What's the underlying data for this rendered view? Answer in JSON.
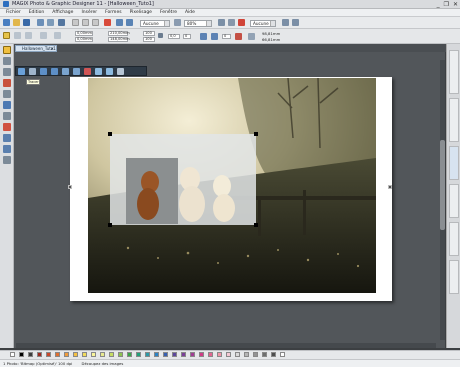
{
  "window": {
    "title": "MAGIX Photo & Graphic Designer 11 - [Halloween_Tuto1]",
    "controls": [
      "_",
      "❐",
      "✕"
    ]
  },
  "menu": [
    "Fichier",
    "Edition",
    "Affichage",
    "Insérer",
    "Formes",
    "Pixelisage",
    "Fenêtre",
    "Aide"
  ],
  "toolbar1": {
    "font_combo": "Aucune",
    "zoom_combo": "80%",
    "mode_combo": "Aucune"
  },
  "toolbar2": {
    "x1": "0,00mm",
    "y1": "0,00mm",
    "w": "210,00mm",
    "h": "148,00mm",
    "scale_w": "100",
    "scale_h": "100",
    "angle": "0,0",
    "val1": "0",
    "val2": "0",
    "pix1": "98,81mm",
    "pix2": "66,81mm"
  },
  "tabs": {
    "doc_tab": "Halloween_Tuto1",
    "close": "×"
  },
  "tooltip": "Tracer",
  "context_toolbar": {
    "icon_names": [
      "picture-icon",
      "crop-icon",
      "adjust-icon",
      "rotate-icon",
      "eye-icon",
      "fx-icon",
      "mask-icon",
      "frame-icon",
      "photo-icon",
      "export-icon"
    ]
  },
  "status": {
    "left": "1 Photo: 'Bitmap (Optimisé)' 100 dpi",
    "right": "Découpez des images"
  },
  "palette": {
    "colors": [
      "#ffffff",
      "#000000",
      "#3c3c3c",
      "#9e2a1f",
      "#c8472a",
      "#e07031",
      "#f09b3b",
      "#f5c042",
      "#f2dc5d",
      "#f9f59a",
      "#e7e98f",
      "#c6dd62",
      "#8dc34f",
      "#3aa648",
      "#23a07a",
      "#2d9aa8",
      "#2c83c5",
      "#3760b2",
      "#5c469d",
      "#7b3f99",
      "#a13d94",
      "#d03c86",
      "#e36590",
      "#f295a8",
      "#f4c8d3",
      "#d9d9d9",
      "#b5b5b5",
      "#939393",
      "#6e6e6e",
      "#4d4d4d",
      "#ffffff"
    ]
  }
}
